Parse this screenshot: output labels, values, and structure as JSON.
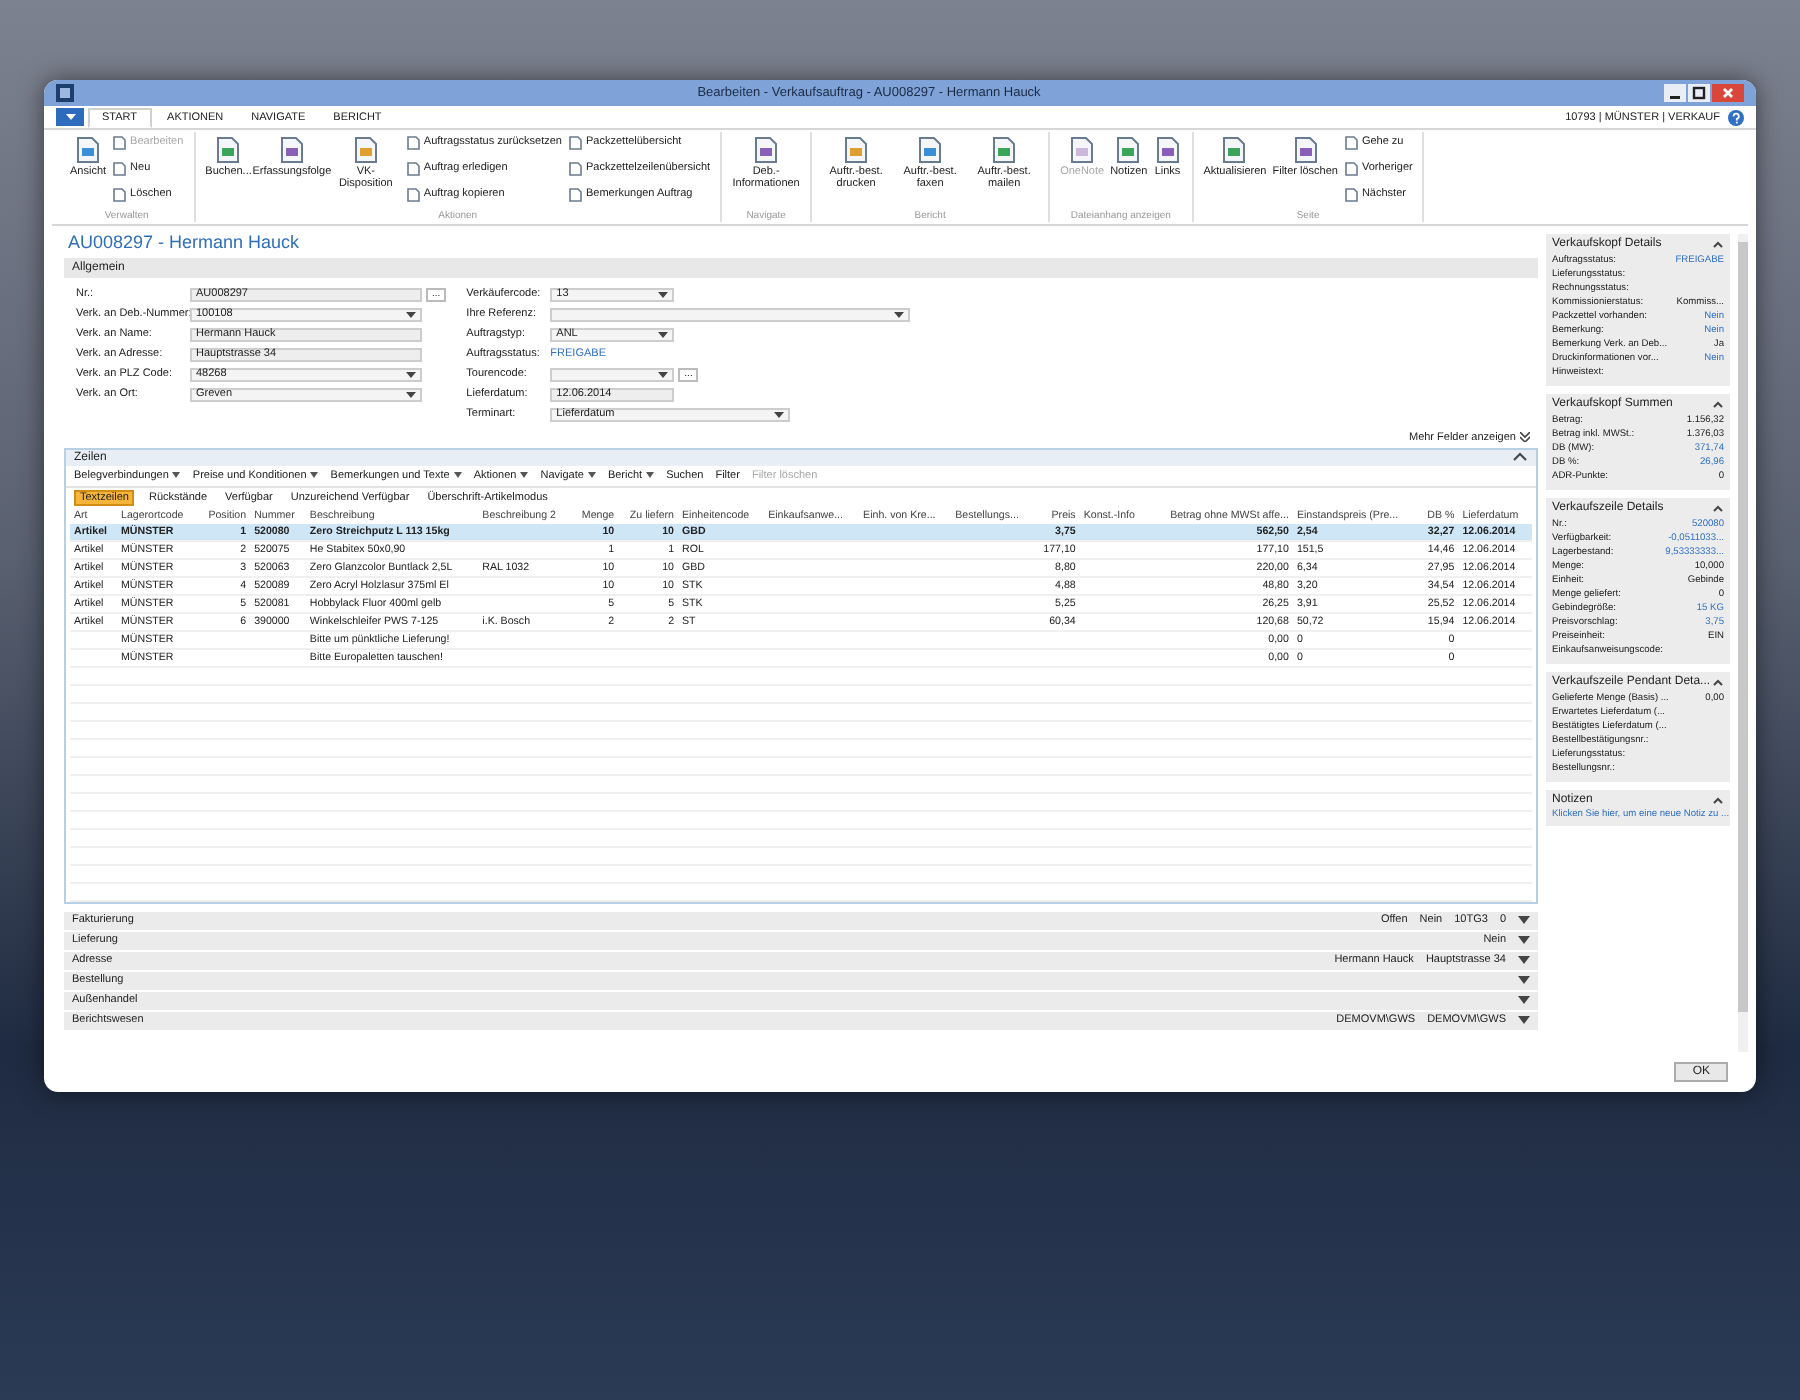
{
  "window": {
    "title": "Bearbeiten - Verkaufsauftrag - AU008297 - Hermann Hauck"
  },
  "ribbon": {
    "tabs": [
      {
        "label": "START",
        "selected": true
      },
      {
        "label": "AKTIONEN",
        "selected": false
      },
      {
        "label": "NAVIGATE",
        "selected": false
      },
      {
        "label": "BERICHT",
        "selected": false
      }
    ],
    "user_info": "10793 | MÜNSTER | VERKAUF",
    "groups": [
      {
        "label": "Verwalten",
        "actions": [
          {
            "label": "Ansicht",
            "kind": "large",
            "disabled": false
          },
          {
            "label": "Bearbeiten",
            "kind": "small",
            "disabled": true
          },
          {
            "label": "Neu",
            "kind": "small",
            "disabled": false
          },
          {
            "label": "Löschen",
            "kind": "small",
            "disabled": false
          }
        ]
      },
      {
        "label": "Aktionen",
        "actions": [
          {
            "label": "Buchen...",
            "kind": "large",
            "disabled": false
          },
          {
            "label": "Erfassungsfolge",
            "kind": "large",
            "disabled": false
          },
          {
            "label": "VK-Disposition",
            "kind": "large",
            "disabled": false
          },
          {
            "label": "Auftragsstatus zurücksetzen",
            "kind": "small",
            "disabled": false
          },
          {
            "label": "Auftrag erledigen",
            "kind": "small",
            "disabled": false
          },
          {
            "label": "Auftrag kopieren",
            "kind": "small",
            "disabled": false
          },
          {
            "label": "Packzettelübersicht",
            "kind": "small",
            "disabled": false
          },
          {
            "label": "Packzettelzeilenübersicht",
            "kind": "small",
            "disabled": false
          },
          {
            "label": "Bemerkungen Auftrag",
            "kind": "small",
            "disabled": false
          }
        ]
      },
      {
        "label": "Navigate",
        "actions": [
          {
            "label": "Deb.-Informationen",
            "kind": "large",
            "disabled": false
          }
        ]
      },
      {
        "label": "Bericht",
        "actions": [
          {
            "label": "Auftr.-best. drucken",
            "kind": "large",
            "disabled": false
          },
          {
            "label": "Auftr.-best. faxen",
            "kind": "large",
            "disabled": false
          },
          {
            "label": "Auftr.-best. mailen",
            "kind": "large",
            "disabled": false
          }
        ]
      },
      {
        "label": "Dateianhang anzeigen",
        "actions": [
          {
            "label": "OneNote",
            "kind": "large",
            "disabled": true
          },
          {
            "label": "Notizen",
            "kind": "large",
            "disabled": false
          },
          {
            "label": "Links",
            "kind": "large",
            "disabled": false
          }
        ]
      },
      {
        "label": "Seite",
        "actions": [
          {
            "label": "Aktualisieren",
            "kind": "large",
            "disabled": false
          },
          {
            "label": "Filter löschen",
            "kind": "large",
            "disabled": false
          },
          {
            "label": "Gehe zu",
            "kind": "small",
            "disabled": false
          },
          {
            "label": "Vorheriger",
            "kind": "small",
            "disabled": false
          },
          {
            "label": "Nächster",
            "kind": "small",
            "disabled": false
          }
        ]
      }
    ]
  },
  "page_title": "AU008297 - Hermann Hauck",
  "general": {
    "title": "Allgemein",
    "more_link": "Mehr Felder anzeigen",
    "left_fields": [
      {
        "label": "Nr.:",
        "value": "AU008297",
        "kind": "lookup",
        "button": "..."
      },
      {
        "label": "Verk. an Deb.-Nummer:",
        "value": "100108",
        "kind": "dropdown"
      },
      {
        "label": "Verk. an Name:",
        "value": "Hermann Hauck",
        "kind": "text"
      },
      {
        "label": "Verk. an Adresse:",
        "value": "Hauptstrasse 34",
        "kind": "text"
      },
      {
        "label": "Verk. an PLZ Code:",
        "value": "48268",
        "kind": "dropdown"
      },
      {
        "label": "Verk. an Ort:",
        "value": "Greven",
        "kind": "dropdown"
      }
    ],
    "right_fields": [
      {
        "label": "Verkäufercode:",
        "value": "13",
        "kind": "dropdown"
      },
      {
        "label": "Ihre Referenz:",
        "kind": "wide_dropdown"
      },
      {
        "label": "Auftragstyp:",
        "value": "ANL",
        "kind": "dropdown"
      },
      {
        "label": "Auftragsstatus:",
        "value": "FREIGABE",
        "kind": "status"
      },
      {
        "label": "Tourencode:",
        "kind": "dropdown_lookup",
        "button": "..."
      },
      {
        "label": "Lieferdatum:",
        "value": "12.06.2014",
        "kind": "text"
      },
      {
        "label": "Terminart:",
        "value": "Lieferdatum",
        "kind": "wide_dropdown"
      }
    ]
  },
  "lines": {
    "title": "Zeilen",
    "toolbar": [
      {
        "label": "Belegverbindungen",
        "dropdown": true,
        "disabled": false
      },
      {
        "label": "Preise und Konditionen",
        "dropdown": true,
        "disabled": false
      },
      {
        "label": "Bemerkungen und Texte",
        "dropdown": true,
        "disabled": false
      },
      {
        "label": "Aktionen",
        "dropdown": true,
        "disabled": false
      },
      {
        "label": "Navigate",
        "dropdown": true,
        "disabled": false
      },
      {
        "label": "Bericht",
        "dropdown": true,
        "disabled": false
      },
      {
        "label": "Suchen",
        "dropdown": false,
        "disabled": false
      },
      {
        "label": "Filter",
        "dropdown": false,
        "disabled": false
      },
      {
        "label": "Filter löschen",
        "dropdown": false,
        "disabled": true
      }
    ],
    "tabs": [
      {
        "label": "Textzeilen",
        "selected": true
      },
      {
        "label": "Rückstände",
        "selected": false
      },
      {
        "label": "Verfügbar",
        "selected": false
      },
      {
        "label": "Unzureichend Verfügbar",
        "selected": false
      },
      {
        "label": "Überschrift-Artikelmodus",
        "selected": false
      }
    ],
    "columns": [
      "Art",
      "Lagerortcode",
      "Position",
      "Nummer",
      "Beschreibung",
      "Beschreibung 2",
      "Menge",
      "Zu liefern",
      "Einheitencode",
      "Einkaufsanwe...",
      "Einh. von Kre...",
      "Bestellungs...",
      "Preis",
      "Konst.-Info",
      "Betrag ohne MWSt affe...",
      "Einstandspreis (Pre...",
      "DB %",
      "Lieferdatum"
    ],
    "rows": [
      {
        "selected": true,
        "cells": [
          "Artikel",
          "MÜNSTER",
          "1",
          "520080",
          "Zero Streichputz L 113 15kg",
          null,
          "10",
          "10",
          "GBD",
          null,
          null,
          null,
          "3,75",
          null,
          "562,50",
          "2,54",
          "32,27",
          "12.06.2014"
        ]
      },
      {
        "selected": false,
        "cells": [
          "Artikel",
          "MÜNSTER",
          "2",
          "520075",
          "He Stabitex 50x0,90",
          null,
          "1",
          "1",
          "ROL",
          null,
          null,
          null,
          "177,10",
          null,
          "177,10",
          "151,5",
          "14,46",
          "12.06.2014"
        ]
      },
      {
        "selected": false,
        "cells": [
          "Artikel",
          "MÜNSTER",
          "3",
          "520063",
          "Zero Glanzcolor Buntlack 2,5L",
          "RAL 1032",
          "10",
          "10",
          "GBD",
          null,
          null,
          null,
          "8,80",
          null,
          "220,00",
          "6,34",
          "27,95",
          "12.06.2014"
        ]
      },
      {
        "selected": false,
        "cells": [
          "Artikel",
          "MÜNSTER",
          "4",
          "520089",
          "Zero Acryl Holzlasur 375ml El",
          null,
          "10",
          "10",
          "STK",
          null,
          null,
          null,
          "4,88",
          null,
          "48,80",
          "3,20",
          "34,54",
          "12.06.2014"
        ]
      },
      {
        "selected": false,
        "cells": [
          "Artikel",
          "MÜNSTER",
          "5",
          "520081",
          "Hobbylack Fluor 400ml gelb",
          null,
          "5",
          "5",
          "STK",
          null,
          null,
          null,
          "5,25",
          null,
          "26,25",
          "3,91",
          "25,52",
          "12.06.2014"
        ]
      },
      {
        "selected": false,
        "cells": [
          "Artikel",
          "MÜNSTER",
          "6",
          "390000",
          "Winkelschleifer PWS 7-125",
          "i.K. Bosch",
          "2",
          "2",
          "ST",
          null,
          null,
          null,
          "60,34",
          null,
          "120,68",
          "50,72",
          "15,94",
          "12.06.2014"
        ]
      },
      {
        "selected": false,
        "cells": [
          null,
          "MÜNSTER",
          null,
          null,
          "Bitte um pünktliche Lieferung!",
          null,
          null,
          null,
          null,
          null,
          null,
          null,
          null,
          null,
          "0,00",
          "0",
          "0",
          null
        ]
      },
      {
        "selected": false,
        "cells": [
          null,
          "MÜNSTER",
          null,
          null,
          "Bitte Europaletten tauschen!",
          null,
          null,
          null,
          null,
          null,
          null,
          null,
          null,
          null,
          "0,00",
          "0",
          "0",
          null
        ]
      }
    ]
  },
  "fasttabs": [
    {
      "title": "Fakturierung",
      "summary": [
        "Offen",
        "Nein",
        "10TG3",
        "0"
      ]
    },
    {
      "title": "Lieferung",
      "summary": [
        "Nein"
      ]
    },
    {
      "title": "Adresse",
      "summary": [
        "Hermann Hauck",
        "Hauptstrasse 34"
      ]
    },
    {
      "title": "Bestellung"
    },
    {
      "title": "Außenhandel"
    },
    {
      "title": "Berichtswesen",
      "summary": [
        "DEMOVM\\GWS",
        "DEMOVM\\GWS"
      ]
    }
  ],
  "factboxes": [
    {
      "title": "Verkaufskopf Details",
      "rows": [
        {
          "label": "Auftragsstatus:",
          "value": "FREIGABE",
          "link": true
        },
        {
          "label": "Lieferungsstatus:"
        },
        {
          "label": "Rechnungsstatus:"
        },
        {
          "label": "Kommissionierstatus:",
          "value": "Kommiss...",
          "link": false
        },
        {
          "label": "Packzettel vorhanden:",
          "value": "Nein",
          "link": true
        },
        {
          "label": "Bemerkung:",
          "value": "Nein",
          "link": true
        },
        {
          "label": "Bemerkung Verk. an Deb...",
          "value": "Ja",
          "link": false
        },
        {
          "label": "Druckinformationen vor...",
          "value": "Nein",
          "link": true
        },
        {
          "label": "Hinweistext:"
        }
      ]
    },
    {
      "title": "Verkaufskopf Summen",
      "rows": [
        {
          "label": "Betrag:",
          "value": "1.156,32",
          "link": false
        },
        {
          "label": "Betrag inkl. MWSt.:",
          "value": "1.376,03",
          "link": false
        },
        {
          "label": "DB (MW):",
          "value": "371,74",
          "link": true
        },
        {
          "label": "DB %:",
          "value": "26,96",
          "link": true
        },
        {
          "label": "ADR-Punkte:",
          "value": "0",
          "link": false
        }
      ]
    },
    {
      "title": "Verkaufszeile Details",
      "rows": [
        {
          "label": "Nr.:",
          "value": "520080",
          "link": true
        },
        {
          "label": "Verfügbarkeit:",
          "value": "-0,0511033...",
          "link": true
        },
        {
          "label": "Lagerbestand:",
          "value": "9,53333333...",
          "link": true
        },
        {
          "label": "Menge:",
          "value": "10,000",
          "link": false
        },
        {
          "label": "Einheit:",
          "value": "Gebinde",
          "link": false
        },
        {
          "label": "Menge geliefert:",
          "value": "0",
          "link": false
        },
        {
          "label": "Gebindegröße:",
          "value": "15 KG",
          "link": true
        },
        {
          "label": "Preisvorschlag:",
          "value": "3,75",
          "link": true
        },
        {
          "label": "Preiseinheit:",
          "value": "EIN",
          "link": false
        },
        {
          "label": "Einkaufsanweisungscode:"
        }
      ]
    },
    {
      "title": "Verkaufszeile Pendant Deta...",
      "rows": [
        {
          "label": "Gelieferte Menge (Basis) ...",
          "value": "0,00",
          "link": false
        },
        {
          "label": "Erwartetes Lieferdatum (..."
        },
        {
          "label": "Bestätigtes Lieferdatum (..."
        },
        {
          "label": "Bestellbestätigungsnr.:"
        },
        {
          "label": "Lieferungsstatus:"
        },
        {
          "label": "Bestellungsnr.:"
        }
      ]
    },
    {
      "title": "Notizen",
      "note_link": "Klicken Sie hier, um eine neue Notiz zu ..."
    }
  ],
  "ok_button": "OK"
}
